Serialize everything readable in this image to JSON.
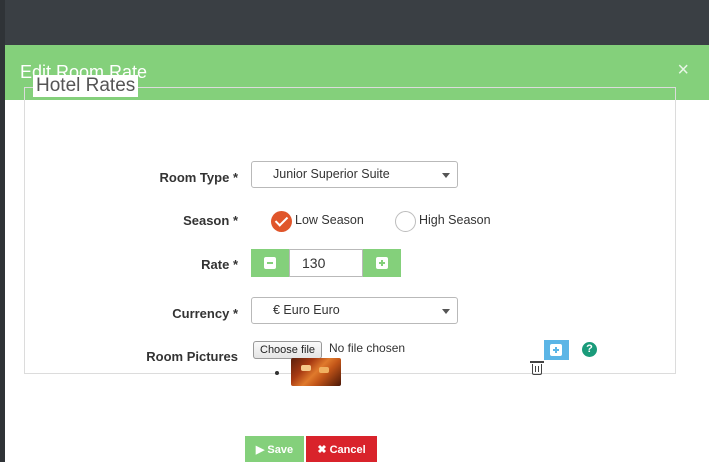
{
  "modal": {
    "title": "Edit Room Rate",
    "close": "×"
  },
  "form": {
    "legend": "Hotel Rates",
    "room_type": {
      "label": "Room Type",
      "required": "*",
      "value": "Junior Superior Suite"
    },
    "season": {
      "label": "Season",
      "required": "*",
      "options": [
        {
          "label": "Low Season",
          "checked": true
        },
        {
          "label": "High Season",
          "checked": false
        }
      ]
    },
    "rate": {
      "label": "Rate",
      "required": "*",
      "value": "130"
    },
    "currency": {
      "label": "Currency",
      "required": "*",
      "value": "€ Euro Euro"
    },
    "pictures": {
      "label": "Room Pictures",
      "choose_file": "Choose file",
      "file_status": "No file chosen",
      "help": "?"
    }
  },
  "footer": {
    "save_label": "Save",
    "cancel_label": "Cancel"
  },
  "colors": {
    "header": "#84d07b",
    "checked_radio": "#e0562b",
    "cancel": "#d9232b",
    "add_picture": "#5bb5e6",
    "help": "#1a9b7a"
  }
}
